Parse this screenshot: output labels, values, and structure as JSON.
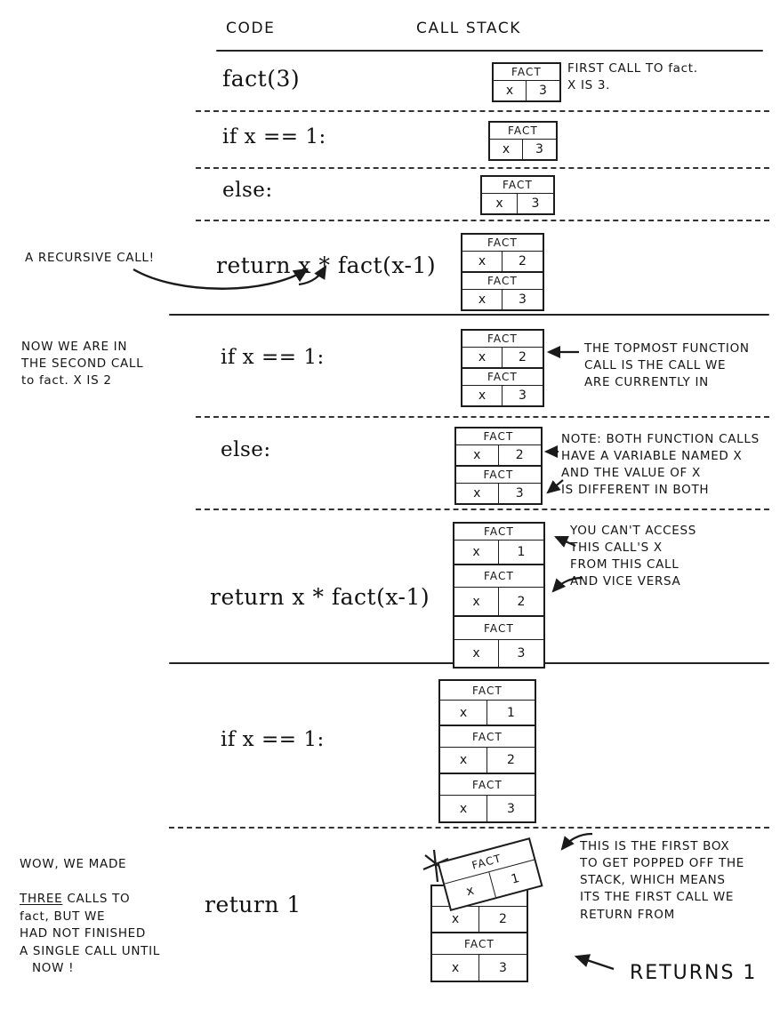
{
  "headers": {
    "code": "CODE",
    "call_stack": "CALL STACK"
  },
  "frame_label": "FACT",
  "var_name": "x",
  "steps": [
    {
      "code": "fact(3)",
      "stack": [
        {
          "name": "FACT",
          "var": "x",
          "value": "3"
        }
      ]
    },
    {
      "code": "if x == 1:",
      "stack": [
        {
          "name": "FACT",
          "var": "x",
          "value": "3"
        }
      ]
    },
    {
      "code": "else:",
      "stack": [
        {
          "name": "FACT",
          "var": "x",
          "value": "3"
        }
      ]
    },
    {
      "code": "return x * fact(x-1)",
      "stack": [
        {
          "name": "FACT",
          "var": "x",
          "value": "2"
        },
        {
          "name": "FACT",
          "var": "x",
          "value": "3"
        }
      ]
    },
    {
      "code": "if x == 1:",
      "stack": [
        {
          "name": "FACT",
          "var": "x",
          "value": "2"
        },
        {
          "name": "FACT",
          "var": "x",
          "value": "3"
        }
      ]
    },
    {
      "code": "else:",
      "stack": [
        {
          "name": "FACT",
          "var": "x",
          "value": "2"
        },
        {
          "name": "FACT",
          "var": "x",
          "value": "3"
        }
      ]
    },
    {
      "code": "return x * fact(x-1)",
      "stack": [
        {
          "name": "FACT",
          "var": "x",
          "value": "1"
        },
        {
          "name": "FACT",
          "var": "x",
          "value": "2"
        },
        {
          "name": "FACT",
          "var": "x",
          "value": "3"
        }
      ]
    },
    {
      "code": "if x == 1:",
      "stack": [
        {
          "name": "FACT",
          "var": "x",
          "value": "1"
        },
        {
          "name": "FACT",
          "var": "x",
          "value": "2"
        },
        {
          "name": "FACT",
          "var": "x",
          "value": "3"
        }
      ]
    },
    {
      "code": "return 1",
      "stack": [
        {
          "name": "FACT",
          "var": "x",
          "value": "2"
        },
        {
          "name": "FACT",
          "var": "x",
          "value": "3"
        }
      ],
      "popped": {
        "name": "FACT",
        "var": "x",
        "value": "1"
      }
    }
  ],
  "annotations": {
    "first_call": "FIRST CALL TO fact.\n  X IS 3.",
    "recursive_call": "A RECURSIVE CALL!",
    "second_call": "NOW WE ARE IN\nTHE SECOND CALL\nto fact. X IS 2",
    "topmost": "THE TOPMOST FUNCTION\nCALL IS THE CALL WE\nARE CURRENTLY IN",
    "both_have_x": "NOTE: BOTH FUNCTION CALLS\nHAVE A VARIABLE NAMED X\nAND THE VALUE OF X\nIS DIFFERENT IN BOTH",
    "cant_access": "YOU CAN'T ACCESS\nTHIS CALL'S X\nFROM THIS CALL\nAND VICE VERSA",
    "first_popped": "THIS IS THE FIRST BOX\nTO GET POPPED OFF THE\nSTACK, WHICH MEANS\nITS THE FIRST CALL WE\nRETURN FROM",
    "wow_line1": "WOW, WE MADE",
    "wow_three": "THREE",
    "wow_line2": " CALLS TO",
    "wow_line3": "fact, BUT WE",
    "wow_line4": "HAD NOT FINISHED",
    "wow_line5": "A SINGLE CALL UNTIL",
    "wow_line6": "NOW !",
    "returns_one": "RETURNS 1"
  },
  "colors": {
    "ink": "#1a1a1a",
    "paper": "#ffffff"
  }
}
